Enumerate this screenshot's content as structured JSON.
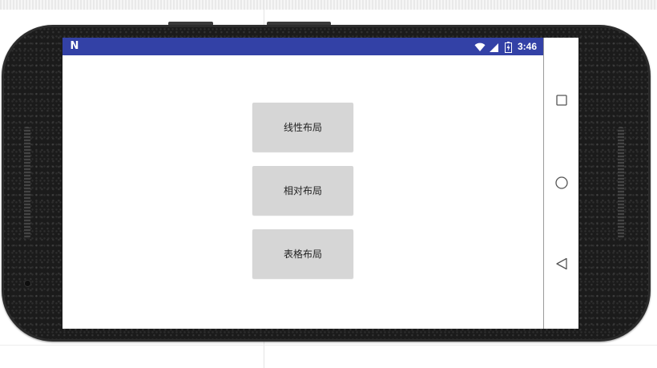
{
  "status_bar": {
    "notification_icon": "n-icon",
    "notification_glyph": "N",
    "wifi_icon": "wifi-icon",
    "signal_icon": "signal-icon",
    "battery_icon": "battery-icon",
    "time": "3:46",
    "background_color": "#3341a6"
  },
  "app": {
    "buttons": [
      {
        "label": "线性布局"
      },
      {
        "label": "相对布局"
      },
      {
        "label": "表格布局"
      }
    ]
  },
  "nav_bar": {
    "recents_icon": "square-icon",
    "home_icon": "circle-icon",
    "back_icon": "triangle-back-icon"
  },
  "colors": {
    "device_body": "#1b1b1b",
    "button_bg": "#d6d6d6",
    "screen_bg": "#ffffff"
  }
}
